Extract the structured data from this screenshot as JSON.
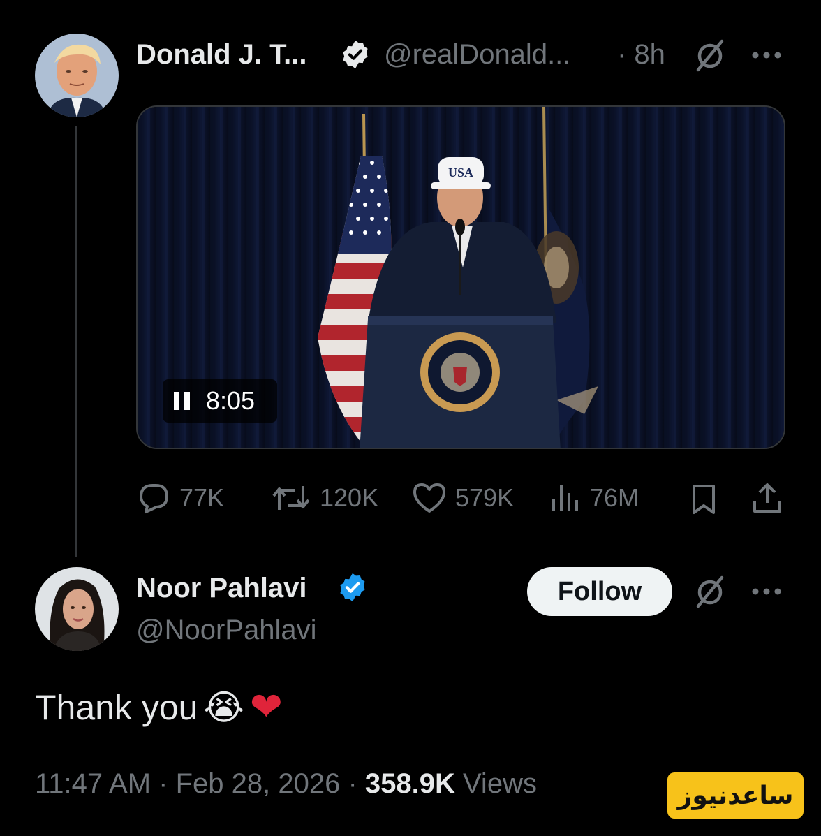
{
  "main_tweet": {
    "display_name": "Donald J. T...",
    "handle": "@realDonald...",
    "time": "· 8h",
    "video": {
      "time_label": "8:05",
      "cap_text": "USA"
    },
    "actions": {
      "replies": "77K",
      "reposts": "120K",
      "likes": "579K",
      "views": "76M"
    }
  },
  "reply_tweet": {
    "display_name": "Noor Pahlavi",
    "handle": "@NoorPahlavi",
    "follow_label": "Follow",
    "text": "Thank you",
    "emoji": "😭",
    "heart": "❤",
    "timestamp": "11:47 AM · Feb 28, 2026 · ",
    "views_count": "358.9K",
    "views_label": " Views"
  },
  "watermark": {
    "text": "ساعدنیوز"
  },
  "colors": {
    "background": "#000000",
    "text_primary": "#e7e9ea",
    "text_muted": "#71767b",
    "verified_blue": "#1d9bf0",
    "follow_bg": "#eff3f4",
    "badge_yellow": "#f7c21a"
  }
}
